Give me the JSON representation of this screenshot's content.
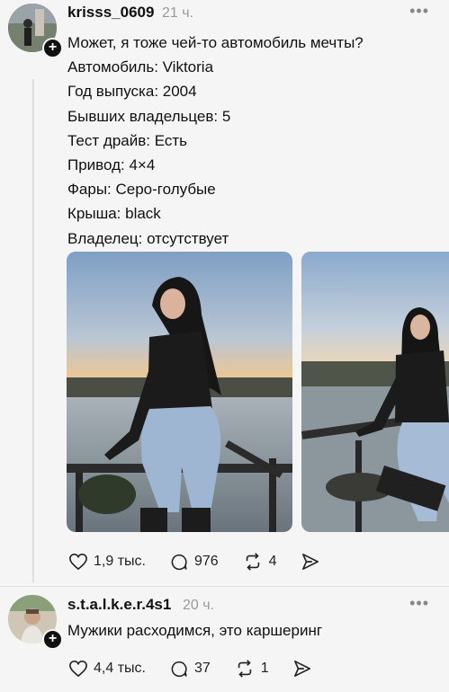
{
  "post1": {
    "username": "krisss_0609",
    "time": "21 ч.",
    "lines": [
      "Может, я тоже чей-то автомобиль мечты?",
      "Автомобиль: Viktoria",
      "Год выпуска: 2004",
      "Бывших владельцев: 5",
      "Тест драйв: Есть",
      "Привод: 4×4",
      "Фары: Серо-голубые",
      "Крыша: black",
      "Владелец: отсутствует"
    ],
    "likes": "1,9 тыс.",
    "comments": "976",
    "reposts": "4"
  },
  "post2": {
    "username": "s.t.a.l.k.e.r.4s1",
    "time": "20 ч.",
    "text": "Мужики расходимся, это каршеринг",
    "likes": "4,4 тыс.",
    "comments": "37",
    "reposts": "1"
  },
  "icons": {
    "more": "more-dots-icon",
    "follow": "plus-icon",
    "like": "heart-icon",
    "comment": "comment-bubble-icon",
    "repost": "repost-icon",
    "share": "send-icon"
  }
}
